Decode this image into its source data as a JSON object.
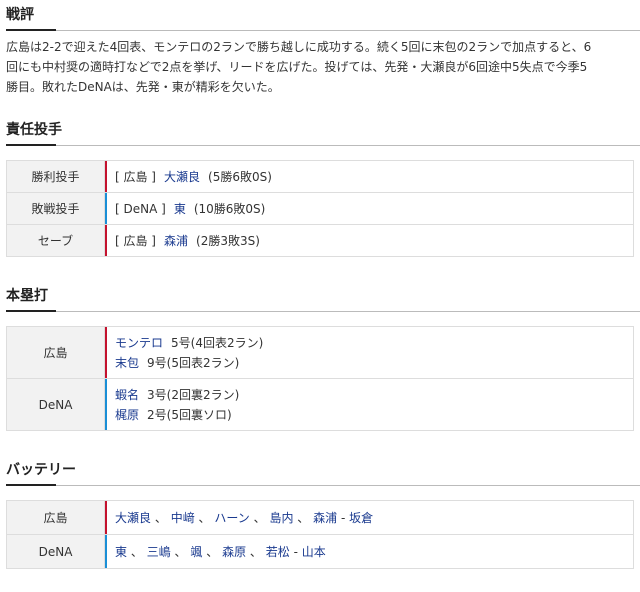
{
  "review": {
    "title": "戦評",
    "text_line1": "広島は2-2で迎えた4回表、モンテロの2ランで勝ち越しに成功する。続く5回に末包の2ランで加点すると、6",
    "text_line2": "回にも中村奨の適時打などで2点を挙げ、リードを広げた。投げては、先発・大瀬良が6回途中5失点で今季5",
    "text_line3": "勝目。敗れたDeNAは、先発・東が精彩を欠いた。"
  },
  "pitchers": {
    "title": "責任投手",
    "rows": [
      {
        "label": "勝利投手",
        "team": "[ 広島 ]",
        "name": "大瀬良",
        "record": "(5勝6敗0S)"
      },
      {
        "label": "敗戦投手",
        "team": "[ DeNA ]",
        "name": "東",
        "record": "(10勝6敗0S)"
      },
      {
        "label": "セーブ",
        "team": "[ 広島 ]",
        "name": "森浦",
        "record": "(2勝3敗3S)"
      }
    ]
  },
  "homeruns": {
    "title": "本塁打",
    "carp_label": "広島",
    "dena_label": "DeNA",
    "carp": [
      {
        "name": "モンテロ",
        "detail": "5号(4回表2ラン)"
      },
      {
        "name": "末包",
        "detail": "9号(5回表2ラン)"
      }
    ],
    "dena": [
      {
        "name": "蝦名",
        "detail": "3号(2回裏2ラン)"
      },
      {
        "name": "梶原",
        "detail": "2号(5回裏ソロ)"
      }
    ]
  },
  "battery": {
    "title": "バッテリー",
    "carp_label": "広島",
    "dena_label": "DeNA",
    "carp_pitchers": [
      "大瀬良",
      "中﨑",
      "ハーン",
      "島内",
      "森浦"
    ],
    "carp_catcher": "坂倉",
    "dena_pitchers": [
      "東",
      "三嶋",
      "颯",
      "森原",
      "若松"
    ],
    "dena_catcher": "山本",
    "sep": "、",
    "dash": "-"
  },
  "colors": {
    "carp": "#c4122e",
    "dena": "#1a8fd6",
    "link": "#1a3a8f"
  }
}
